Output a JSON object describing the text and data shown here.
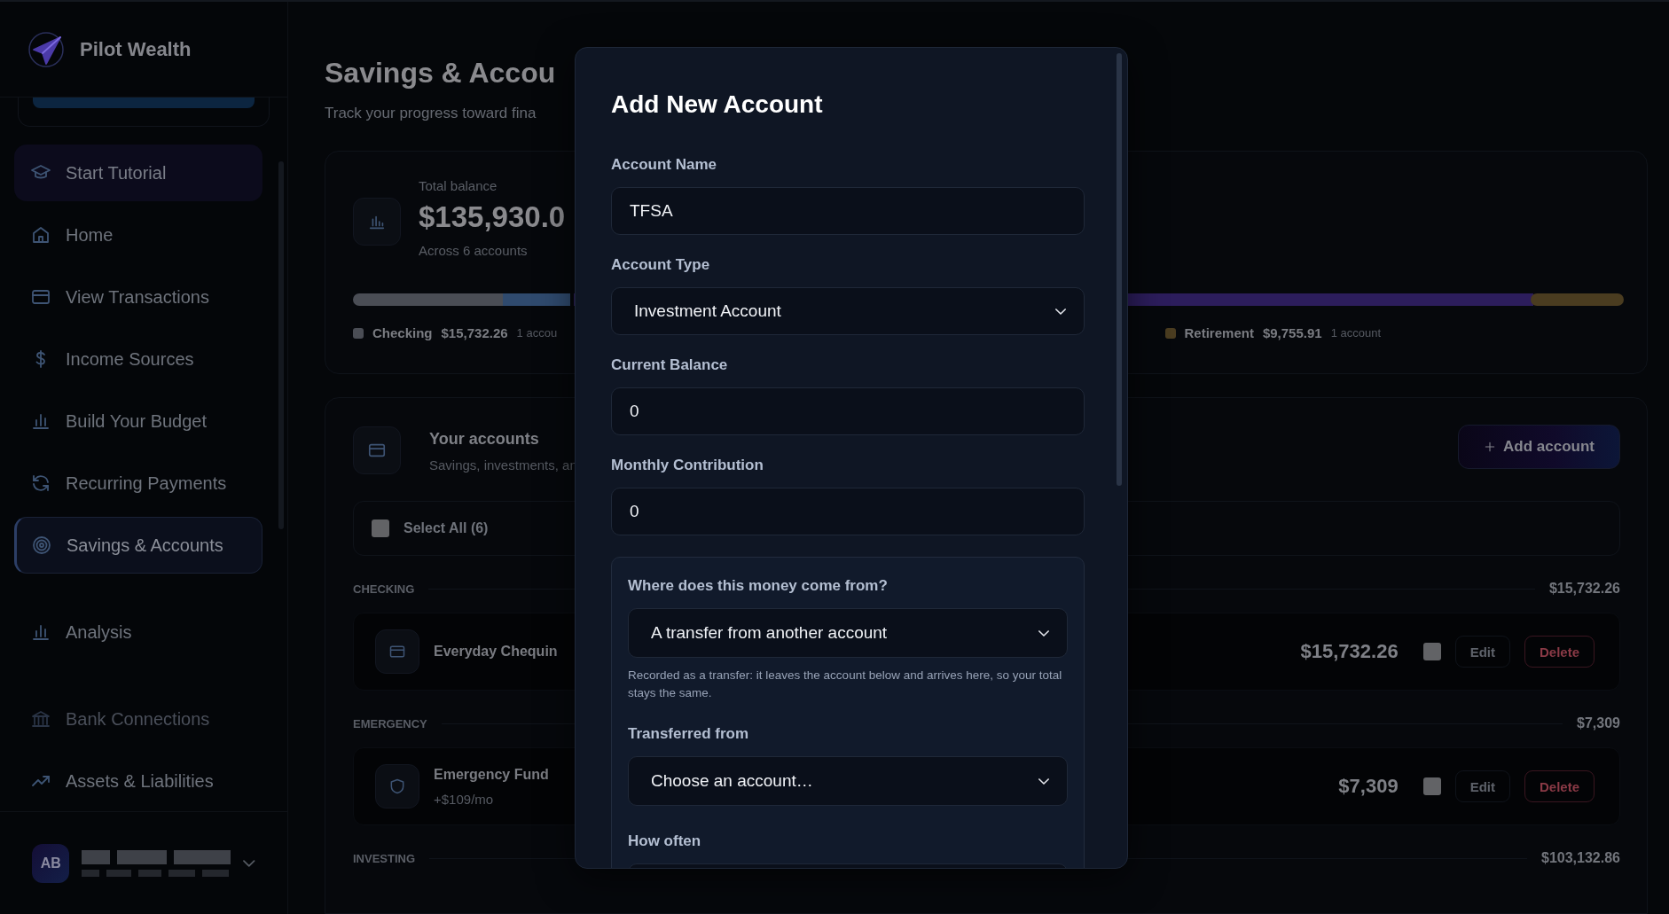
{
  "app": {
    "name": "Pilot Wealth"
  },
  "sidebar": {
    "sections": [
      {
        "items": [
          {
            "label": "Start Tutorial",
            "kind": "tutorial",
            "selected": false,
            "disabled": false
          },
          {
            "label": "Home",
            "kind": "nav",
            "selected": false,
            "disabled": false
          },
          {
            "label": "View Transactions",
            "kind": "nav",
            "selected": false,
            "disabled": false
          },
          {
            "label": "Income Sources",
            "kind": "nav",
            "selected": false,
            "disabled": false
          },
          {
            "label": "Build Your Budget",
            "kind": "nav",
            "selected": false,
            "disabled": false
          },
          {
            "label": "Recurring Payments",
            "kind": "nav",
            "selected": false,
            "disabled": false
          },
          {
            "label": "Savings & Accounts",
            "kind": "nav",
            "selected": true,
            "disabled": false
          }
        ]
      },
      {
        "items": [
          {
            "label": "Analysis",
            "kind": "nav",
            "selected": false,
            "disabled": false
          }
        ]
      },
      {
        "items": [
          {
            "label": "Bank Connections",
            "kind": "nav",
            "selected": false,
            "disabled": true
          },
          {
            "label": "Assets & Liabilities",
            "kind": "nav",
            "selected": false,
            "disabled": false
          }
        ]
      }
    ],
    "user": {
      "initials": "AB"
    }
  },
  "page": {
    "title": "Savings & Accou",
    "subtitle": "Track your progress toward fina"
  },
  "summary": {
    "label": "Total balance",
    "total": "$135,930.0",
    "note": "Across 6 accounts",
    "legend": [
      {
        "name": "Checking",
        "amount": "$15,732.26",
        "count": "1 accou",
        "color": "#4a4d55"
      },
      {
        "name": "Retirement",
        "amount": "$9,755.91",
        "count": "1 account",
        "color": "#4a3c20"
      }
    ]
  },
  "accounts": {
    "title": "Your accounts",
    "subtitle": "Savings, investments, an",
    "add_button": "Add account",
    "select_all": {
      "label": "Select All (6)",
      "checked": false
    },
    "groups": [
      {
        "name": "CHECKING",
        "total": "$15,732.26",
        "accounts": [
          {
            "name": "Everyday Chequin",
            "balance": "$15,732.26",
            "checked": false,
            "edit": "Edit",
            "delete": "Delete"
          }
        ]
      },
      {
        "name": "EMERGENCY",
        "total": "$7,309",
        "accounts": [
          {
            "name": "Emergency Fund",
            "detail": "+$109/mo",
            "balance": "$7,309",
            "checked": false,
            "edit": "Edit",
            "delete": "Delete"
          }
        ]
      },
      {
        "name": "INVESTING",
        "total": "$103,132.86"
      }
    ]
  },
  "modal": {
    "title": "Add New Account",
    "fields": [
      {
        "label": "Account Name",
        "kind": "text",
        "value": "TFSA"
      },
      {
        "label": "Account Type",
        "kind": "select",
        "value": "Investment Account"
      },
      {
        "label": "Current Balance",
        "kind": "text",
        "value": "0"
      },
      {
        "label": "Monthly Contribution",
        "kind": "text",
        "value": "0"
      }
    ],
    "source": {
      "label": "Where does this money come from?",
      "value": "A transfer from another account",
      "help": "Recorded as a transfer: it leaves the account below and arrives here, so your total stays the same.",
      "fields": [
        {
          "label": "Transferred from",
          "kind": "select",
          "value": "Choose an account…"
        },
        {
          "label": "How often",
          "kind": "select"
        }
      ]
    }
  }
}
